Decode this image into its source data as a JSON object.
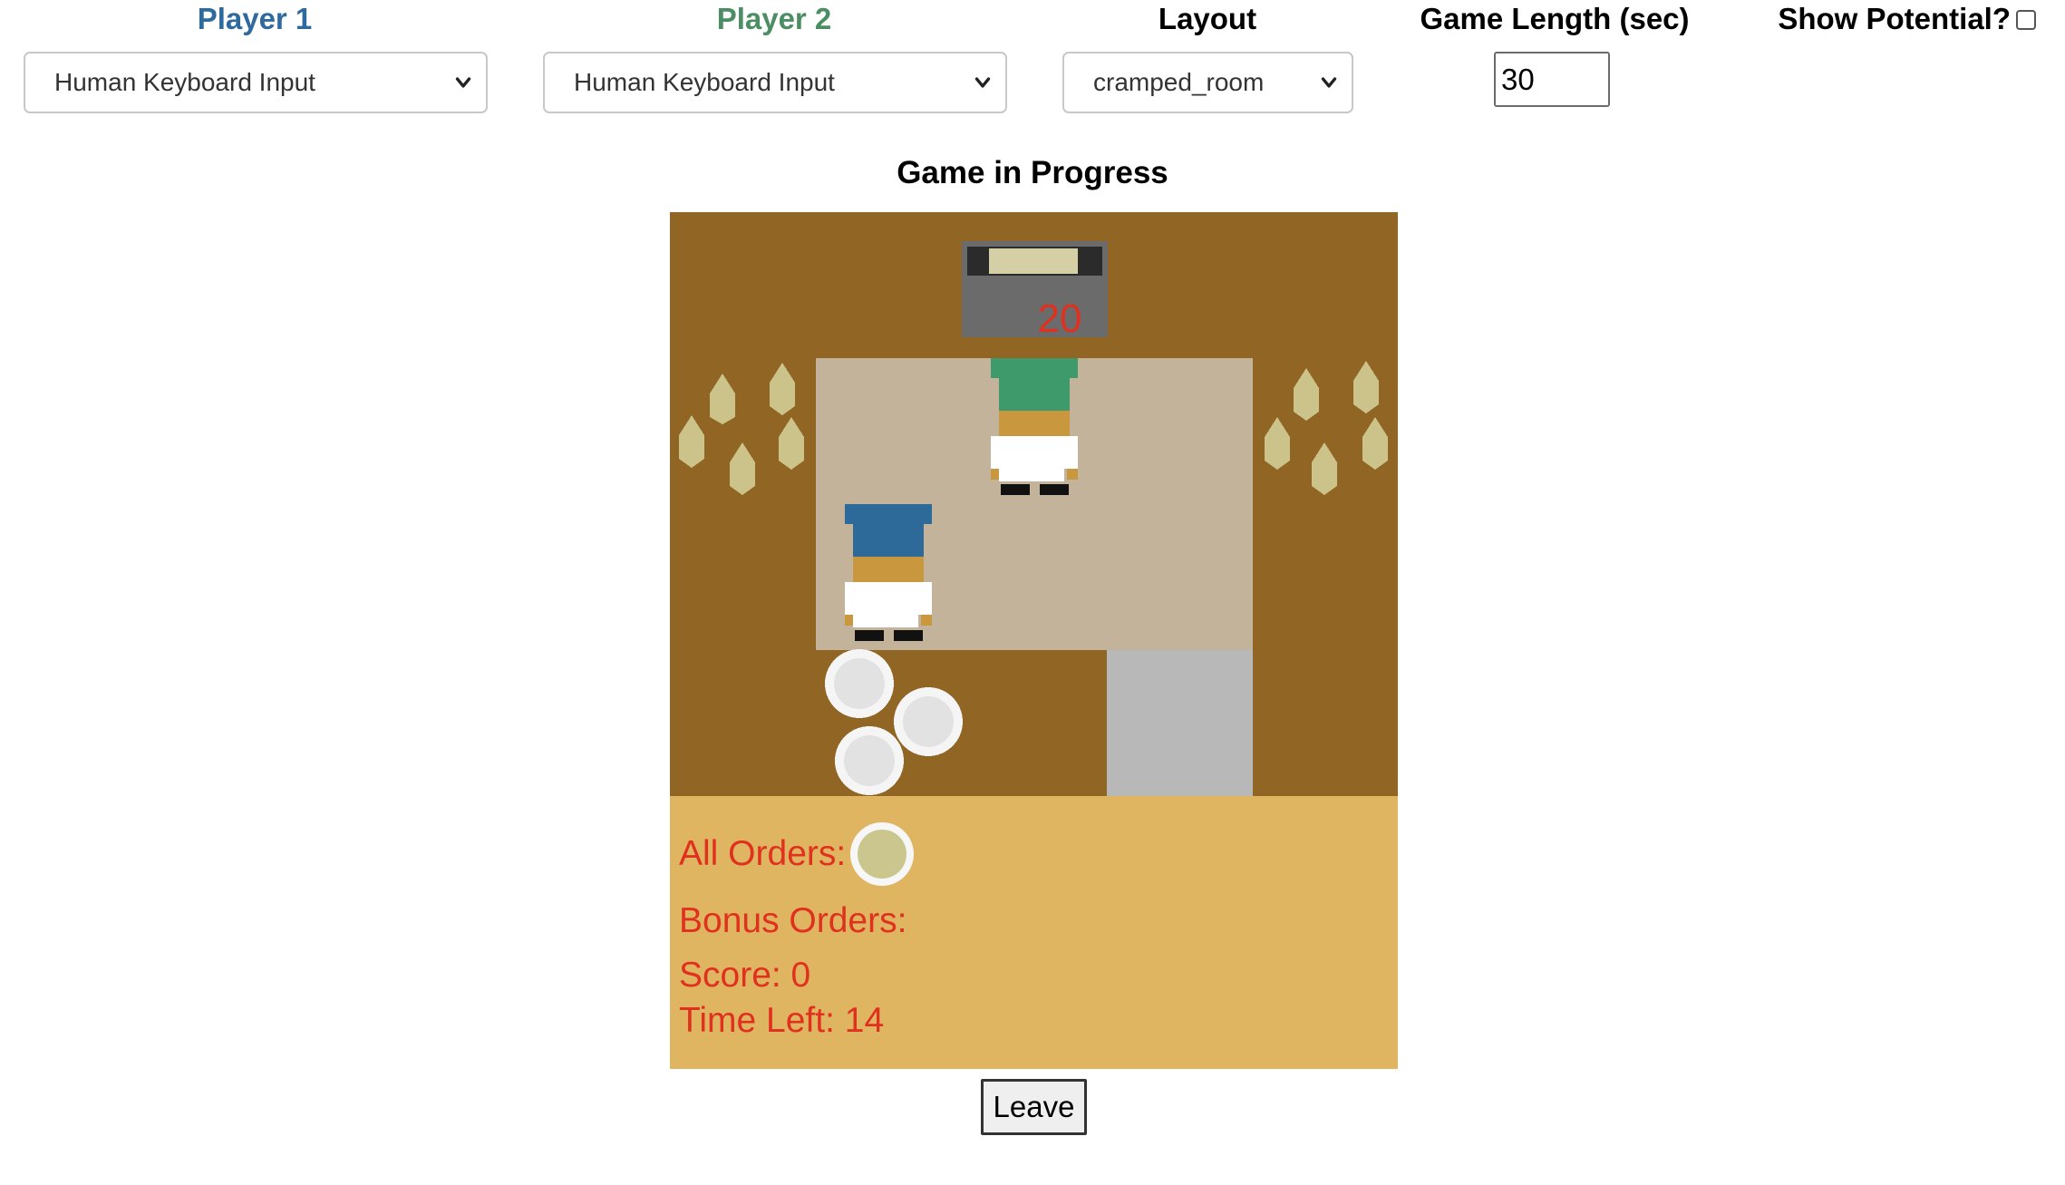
{
  "controls": {
    "player1": {
      "label": "Player 1",
      "color": "#2e6a9e",
      "selected": "Human Keyboard Input"
    },
    "player2": {
      "label": "Player 2",
      "color": "#4b8e63",
      "selected": "Human Keyboard Input"
    },
    "layout": {
      "label": "Layout",
      "selected": "cramped_room"
    },
    "game_length": {
      "label": "Game Length (sec)",
      "value": "30"
    },
    "show_potential": {
      "label": "Show Potential?",
      "checked": false
    }
  },
  "status_title": "Game in Progress",
  "board": {
    "pot_timer": "20",
    "player1_hat_color": "#2d6a99",
    "player2_hat_color": "#3e9a6b"
  },
  "hud": {
    "all_orders_label": "All Orders:",
    "all_orders": [
      "onion-soup-icon"
    ],
    "bonus_orders_label": "Bonus Orders:",
    "score": "Score: 0",
    "time_left": "Time Left: 14"
  },
  "leave_button": "Leave"
}
